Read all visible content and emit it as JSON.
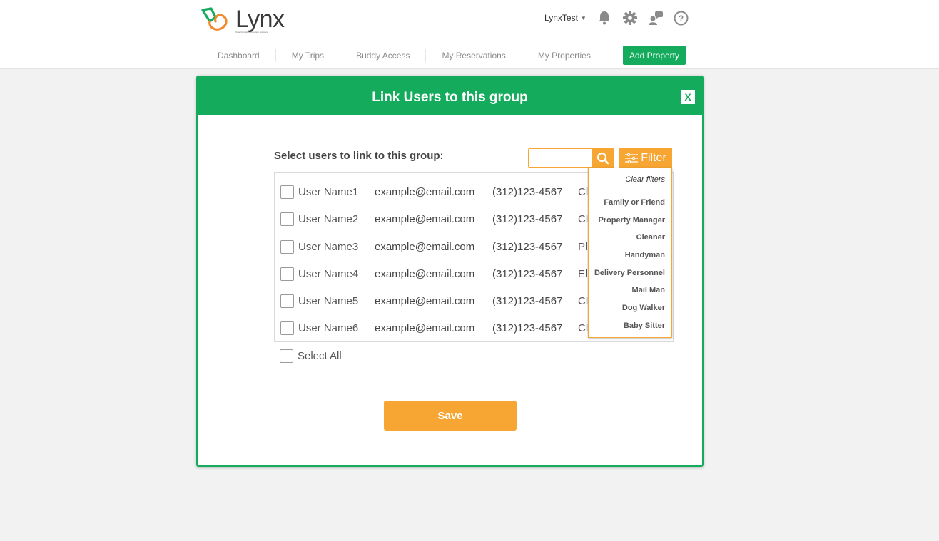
{
  "app": {
    "brand": "Lynx",
    "tagline": "Small Rental Automation Software",
    "colors": {
      "green": "#14ac5c",
      "orange": "#f7a533",
      "background": "#f2f2f2"
    }
  },
  "header": {
    "username": "LynxTest",
    "icons": [
      "bell-icon",
      "gear-icon",
      "support-icon",
      "help-icon"
    ],
    "nav": [
      "Dashboard",
      "My Trips",
      "Buddy Access",
      "My Reservations",
      "My Properties"
    ],
    "add_property": "Add Property"
  },
  "modal": {
    "title": "Link Users to this group",
    "close_label": "X",
    "select_label": "Select users to link to this group:",
    "search_placeholder": "",
    "filter_label": "Filter",
    "users": [
      {
        "name": "User Name1",
        "email": "example@email.com",
        "phone": "(312)123-4567",
        "role": "Cl"
      },
      {
        "name": "User Name2",
        "email": "example@email.com",
        "phone": "(312)123-4567",
        "role": "Cl"
      },
      {
        "name": "User Name3",
        "email": "example@email.com",
        "phone": "(312)123-4567",
        "role": "Pl"
      },
      {
        "name": "User Name4",
        "email": "example@email.com",
        "phone": "(312)123-4567",
        "role": "El"
      },
      {
        "name": "User Name5",
        "email": "example@email.com",
        "phone": "(312)123-4567",
        "role": "Cl"
      },
      {
        "name": "User Name6",
        "email": "example@email.com",
        "phone": "(312)123-4567",
        "role": "Cl"
      }
    ],
    "select_all_label": "Select All",
    "save_label": "Save"
  },
  "filter_dropdown": {
    "clear_label": "Clear filters",
    "options": [
      "Family or Friend",
      "Property Manager",
      "Cleaner",
      "Handyman",
      "Delivery Personnel",
      "Mail Man",
      "Dog Walker",
      "Baby Sitter"
    ]
  }
}
